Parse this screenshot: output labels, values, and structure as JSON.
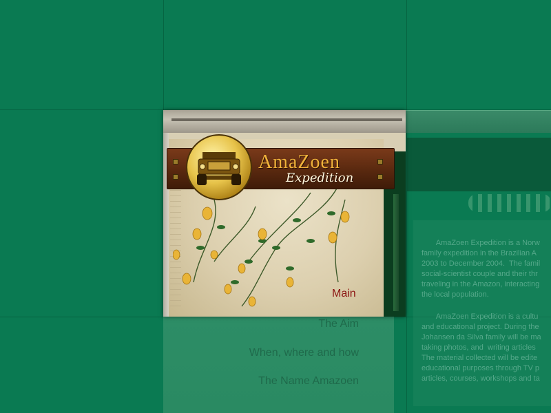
{
  "brand": {
    "title": "AmaZoen",
    "subtitle": "Expedition",
    "logo_icon": "jeep-icon"
  },
  "menu": {
    "items": [
      {
        "label": "Main"
      },
      {
        "label": "The Aim"
      },
      {
        "label": "When, where and how"
      },
      {
        "label": "The Name Amazoen"
      }
    ]
  },
  "content": {
    "paragraph1": "       AmaZoen Expedition is a Norw\nfamily expedition in the Brazilian A\n2003 to December 2004.  The famil\nsocial-scientist couple and their thr\ntraveling in the Amazon, interacting\nthe local population.",
    "paragraph2": "       AmaZoen Expedition is a cultu\nand educational project. During the\nJohansen da Silva family will be ma\ntaking photos, and  writing articles\nThe material collected will be edite\neducational purposes through TV p\narticles, courses, workshops and ta"
  },
  "colors": {
    "overlay_green": "#0a7a52",
    "sign_wood": "#5c2a10",
    "brand_gold": "#f0b13a",
    "menu_active": "#8b1210"
  }
}
